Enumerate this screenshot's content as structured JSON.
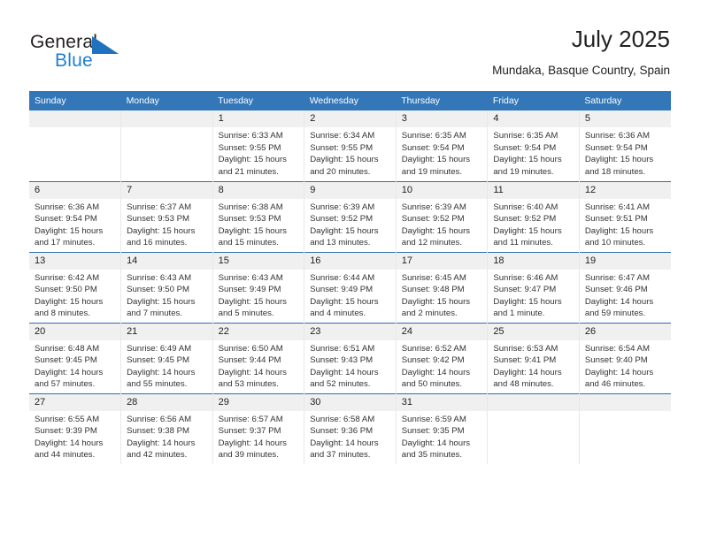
{
  "brand": {
    "name_top": "General",
    "name_bottom": "Blue",
    "color_dark": "#231f20",
    "color_blue": "#1f7fd0"
  },
  "header": {
    "title": "July 2025",
    "subtitle": "Mundaka, Basque Country, Spain"
  },
  "theme": {
    "header_blue": "#3377b8",
    "row_divider_blue": "#2f6fae",
    "daynum_bg": "#f0f0f0",
    "cell_divider": "#e8e8e8"
  },
  "weekday_headers": [
    "Sunday",
    "Monday",
    "Tuesday",
    "Wednesday",
    "Thursday",
    "Friday",
    "Saturday"
  ],
  "weeks": [
    [
      {
        "day": "",
        "sunrise": "",
        "sunset": "",
        "daylight": ""
      },
      {
        "day": "",
        "sunrise": "",
        "sunset": "",
        "daylight": ""
      },
      {
        "day": "1",
        "sunrise": "Sunrise: 6:33 AM",
        "sunset": "Sunset: 9:55 PM",
        "daylight": "Daylight: 15 hours and 21 minutes."
      },
      {
        "day": "2",
        "sunrise": "Sunrise: 6:34 AM",
        "sunset": "Sunset: 9:55 PM",
        "daylight": "Daylight: 15 hours and 20 minutes."
      },
      {
        "day": "3",
        "sunrise": "Sunrise: 6:35 AM",
        "sunset": "Sunset: 9:54 PM",
        "daylight": "Daylight: 15 hours and 19 minutes."
      },
      {
        "day": "4",
        "sunrise": "Sunrise: 6:35 AM",
        "sunset": "Sunset: 9:54 PM",
        "daylight": "Daylight: 15 hours and 19 minutes."
      },
      {
        "day": "5",
        "sunrise": "Sunrise: 6:36 AM",
        "sunset": "Sunset: 9:54 PM",
        "daylight": "Daylight: 15 hours and 18 minutes."
      }
    ],
    [
      {
        "day": "6",
        "sunrise": "Sunrise: 6:36 AM",
        "sunset": "Sunset: 9:54 PM",
        "daylight": "Daylight: 15 hours and 17 minutes."
      },
      {
        "day": "7",
        "sunrise": "Sunrise: 6:37 AM",
        "sunset": "Sunset: 9:53 PM",
        "daylight": "Daylight: 15 hours and 16 minutes."
      },
      {
        "day": "8",
        "sunrise": "Sunrise: 6:38 AM",
        "sunset": "Sunset: 9:53 PM",
        "daylight": "Daylight: 15 hours and 15 minutes."
      },
      {
        "day": "9",
        "sunrise": "Sunrise: 6:39 AM",
        "sunset": "Sunset: 9:52 PM",
        "daylight": "Daylight: 15 hours and 13 minutes."
      },
      {
        "day": "10",
        "sunrise": "Sunrise: 6:39 AM",
        "sunset": "Sunset: 9:52 PM",
        "daylight": "Daylight: 15 hours and 12 minutes."
      },
      {
        "day": "11",
        "sunrise": "Sunrise: 6:40 AM",
        "sunset": "Sunset: 9:52 PM",
        "daylight": "Daylight: 15 hours and 11 minutes."
      },
      {
        "day": "12",
        "sunrise": "Sunrise: 6:41 AM",
        "sunset": "Sunset: 9:51 PM",
        "daylight": "Daylight: 15 hours and 10 minutes."
      }
    ],
    [
      {
        "day": "13",
        "sunrise": "Sunrise: 6:42 AM",
        "sunset": "Sunset: 9:50 PM",
        "daylight": "Daylight: 15 hours and 8 minutes."
      },
      {
        "day": "14",
        "sunrise": "Sunrise: 6:43 AM",
        "sunset": "Sunset: 9:50 PM",
        "daylight": "Daylight: 15 hours and 7 minutes."
      },
      {
        "day": "15",
        "sunrise": "Sunrise: 6:43 AM",
        "sunset": "Sunset: 9:49 PM",
        "daylight": "Daylight: 15 hours and 5 minutes."
      },
      {
        "day": "16",
        "sunrise": "Sunrise: 6:44 AM",
        "sunset": "Sunset: 9:49 PM",
        "daylight": "Daylight: 15 hours and 4 minutes."
      },
      {
        "day": "17",
        "sunrise": "Sunrise: 6:45 AM",
        "sunset": "Sunset: 9:48 PM",
        "daylight": "Daylight: 15 hours and 2 minutes."
      },
      {
        "day": "18",
        "sunrise": "Sunrise: 6:46 AM",
        "sunset": "Sunset: 9:47 PM",
        "daylight": "Daylight: 15 hours and 1 minute."
      },
      {
        "day": "19",
        "sunrise": "Sunrise: 6:47 AM",
        "sunset": "Sunset: 9:46 PM",
        "daylight": "Daylight: 14 hours and 59 minutes."
      }
    ],
    [
      {
        "day": "20",
        "sunrise": "Sunrise: 6:48 AM",
        "sunset": "Sunset: 9:45 PM",
        "daylight": "Daylight: 14 hours and 57 minutes."
      },
      {
        "day": "21",
        "sunrise": "Sunrise: 6:49 AM",
        "sunset": "Sunset: 9:45 PM",
        "daylight": "Daylight: 14 hours and 55 minutes."
      },
      {
        "day": "22",
        "sunrise": "Sunrise: 6:50 AM",
        "sunset": "Sunset: 9:44 PM",
        "daylight": "Daylight: 14 hours and 53 minutes."
      },
      {
        "day": "23",
        "sunrise": "Sunrise: 6:51 AM",
        "sunset": "Sunset: 9:43 PM",
        "daylight": "Daylight: 14 hours and 52 minutes."
      },
      {
        "day": "24",
        "sunrise": "Sunrise: 6:52 AM",
        "sunset": "Sunset: 9:42 PM",
        "daylight": "Daylight: 14 hours and 50 minutes."
      },
      {
        "day": "25",
        "sunrise": "Sunrise: 6:53 AM",
        "sunset": "Sunset: 9:41 PM",
        "daylight": "Daylight: 14 hours and 48 minutes."
      },
      {
        "day": "26",
        "sunrise": "Sunrise: 6:54 AM",
        "sunset": "Sunset: 9:40 PM",
        "daylight": "Daylight: 14 hours and 46 minutes."
      }
    ],
    [
      {
        "day": "27",
        "sunrise": "Sunrise: 6:55 AM",
        "sunset": "Sunset: 9:39 PM",
        "daylight": "Daylight: 14 hours and 44 minutes."
      },
      {
        "day": "28",
        "sunrise": "Sunrise: 6:56 AM",
        "sunset": "Sunset: 9:38 PM",
        "daylight": "Daylight: 14 hours and 42 minutes."
      },
      {
        "day": "29",
        "sunrise": "Sunrise: 6:57 AM",
        "sunset": "Sunset: 9:37 PM",
        "daylight": "Daylight: 14 hours and 39 minutes."
      },
      {
        "day": "30",
        "sunrise": "Sunrise: 6:58 AM",
        "sunset": "Sunset: 9:36 PM",
        "daylight": "Daylight: 14 hours and 37 minutes."
      },
      {
        "day": "31",
        "sunrise": "Sunrise: 6:59 AM",
        "sunset": "Sunset: 9:35 PM",
        "daylight": "Daylight: 14 hours and 35 minutes."
      },
      {
        "day": "",
        "sunrise": "",
        "sunset": "",
        "daylight": ""
      },
      {
        "day": "",
        "sunrise": "",
        "sunset": "",
        "daylight": ""
      }
    ]
  ]
}
